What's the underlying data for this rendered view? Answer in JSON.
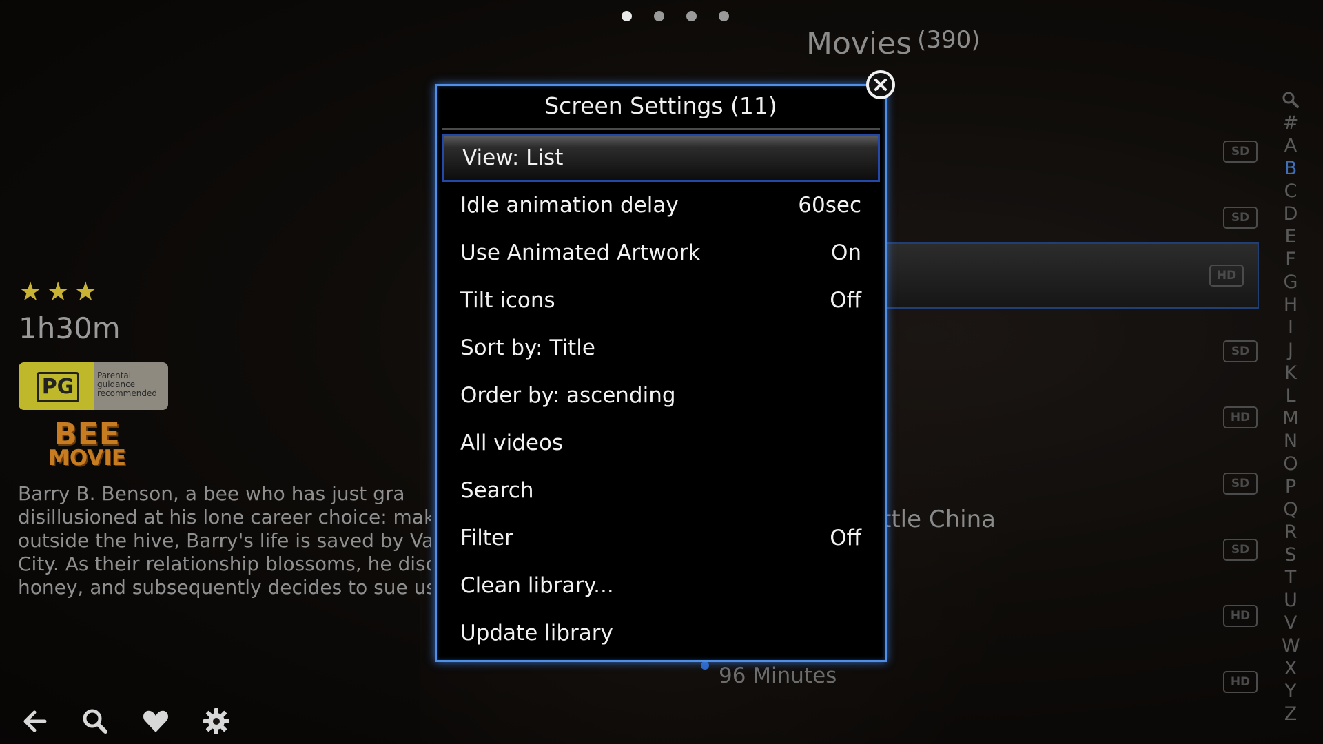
{
  "header": {
    "page_dots": 4,
    "active_dot": 0,
    "section_title": "Movies",
    "section_count": "(390)"
  },
  "alphabet": [
    "#",
    "A",
    "B",
    "C",
    "D",
    "E",
    "F",
    "G",
    "H",
    "I",
    "J",
    "K",
    "L",
    "M",
    "N",
    "O",
    "P",
    "Q",
    "R",
    "S",
    "T",
    "U",
    "V",
    "W",
    "X",
    "Y",
    "Z"
  ],
  "alphabet_active": "B",
  "list_badges": [
    "SD",
    "SD",
    "HD",
    "SD",
    "HD",
    "SD",
    "SD",
    "HD",
    "HD"
  ],
  "list_selected_index": 2,
  "background_text": {
    "partial_title": "ttle China",
    "minutes": "96 Minutes"
  },
  "info_panel": {
    "star_count": 3,
    "runtime": "1h30m",
    "rating_code": "PG",
    "rating_desc": "Parental guidance recommended",
    "logo_line1": "BEE",
    "logo_line2": "MOVIE",
    "plot_lines": [
      "Barry B. Benson, a bee who has just gra",
      "disillusioned at his lone career choice: makin",
      "outside the hive, Barry's life is saved by Vane",
      "City. As their relationship blossoms, he disc",
      "honey, and subsequently decides to sue us."
    ]
  },
  "bottom_nav": {
    "icons": [
      "back-arrow-icon",
      "search-icon",
      "heart-icon",
      "gear-icon"
    ]
  },
  "dialog": {
    "title": "Screen Settings (11)",
    "items": [
      {
        "label": "View: List",
        "value": ""
      },
      {
        "label": "Idle animation delay",
        "value": "60sec"
      },
      {
        "label": "Use Animated Artwork",
        "value": "On"
      },
      {
        "label": "Tilt icons",
        "value": "Off"
      },
      {
        "label": "Sort by: Title",
        "value": ""
      },
      {
        "label": "Order by: ascending",
        "value": ""
      },
      {
        "label": "All videos",
        "value": ""
      },
      {
        "label": "Search",
        "value": ""
      },
      {
        "label": "Filter",
        "value": "Off"
      },
      {
        "label": "Clean library...",
        "value": ""
      },
      {
        "label": "Update library",
        "value": ""
      }
    ],
    "focused_index": 0,
    "close_icon": "close-icon"
  },
  "colors": {
    "accent_blue": "#4f8fe6",
    "focus_border": "#2448a8",
    "star_gold": "#c8b334",
    "alpha_active": "#3f6fb8"
  }
}
